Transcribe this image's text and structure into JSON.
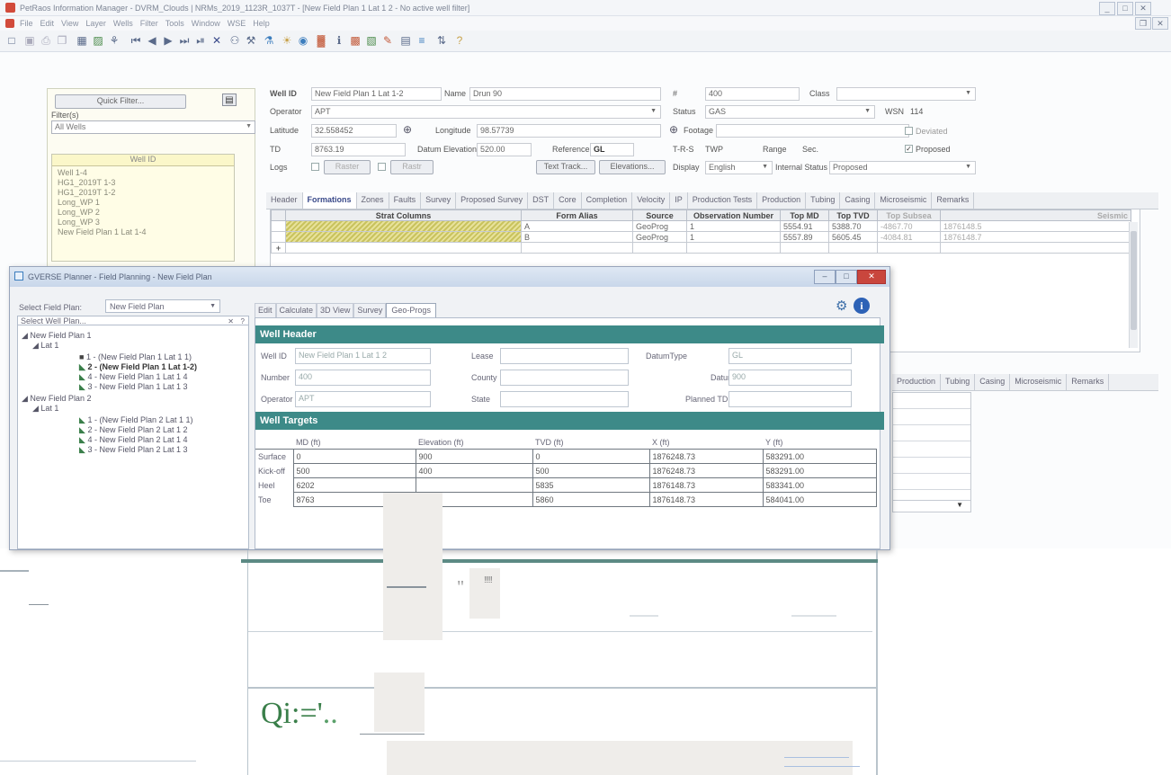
{
  "main_window": {
    "title": "PetRaos Information Manager - DVRM_Clouds | NRMs_2019_1123R_1037T - [New Field Plan 1 Lat 1 2 - No active well filter]",
    "menu": [
      "File",
      "Edit",
      "View",
      "Layer",
      "Wells",
      "Filter",
      "Tools",
      "Window",
      "WSE",
      "Help"
    ],
    "window_controls": [
      "_",
      "□",
      "✕"
    ],
    "toolbar_icons": [
      "new-doc-icon",
      "save-icon",
      "print-icon",
      "grid-icon",
      "chart-icon",
      "filter-icon",
      "first-icon",
      "prev-icon",
      "next-icon",
      "last-icon",
      "add-icon",
      "delete-icon",
      "binoculars-icon",
      "wrench-icon",
      "paint-icon",
      "tag-icon",
      "well-icon",
      "info-icon",
      "flag-icon",
      "check-icon",
      "edit-icon",
      "table-icon",
      "map-icon",
      "refresh-icon",
      "help-icon"
    ]
  },
  "left_panel": {
    "quick_filter_button": "Quick Filter...",
    "filter_label": "Filter(s)",
    "filter_value": "All Wells",
    "wells_header": "Well ID",
    "wells": [
      "Well 1-4",
      "HG1_2019T 1-3",
      "HG1_2019T 1-2",
      "Long_WP 1",
      "Long_WP 2",
      "Long_WP 3",
      "New Field Plan 1 Lat 1-4"
    ]
  },
  "header_form": {
    "well_id_label": "Well ID",
    "well_id_value": "New Field Plan 1 Lat 1-2",
    "name_label": "Name",
    "name_value": "Drun 90",
    "hash_label": "#",
    "hash_value": "400",
    "class_label": "Class",
    "class_value": "",
    "operator_label": "Operator",
    "operator_value": "APT",
    "status_label": "Status",
    "status_value": "GAS",
    "wsn_label": "WSN",
    "wsn_value": "114",
    "latitude_label": "Latitude",
    "latitude_value": "32.558452",
    "longitude_label": "Longitude",
    "longitude_value": "98.57739",
    "footage_label": "Footage",
    "deviated_label": "Deviated",
    "td_label": "TD",
    "td_value": "8763.19",
    "datum_label": "Datum Elevation",
    "datum_value": "520.00",
    "reference_label": "Reference",
    "reference_value": "GL",
    "trs_label": "T-R-S",
    "twp_label": "TWP",
    "range_label": "Range",
    "sec_label": "Sec.",
    "proposed_label": "Proposed",
    "logs_label": "Logs",
    "raster_label": "Raster",
    "rastr_label": "Rastr",
    "text_btn": "Text Track...",
    "elevations_btn": "Elevations...",
    "display_label": "Display",
    "display_value": "English",
    "internal_status_label": "Internal Status",
    "internal_status_value": "Proposed"
  },
  "tabs_top": [
    "Header",
    "Formations",
    "Zones",
    "Faults",
    "Survey",
    "Proposed Survey",
    "DST",
    "Core",
    "Completion",
    "Velocity",
    "IP",
    "Production Tests",
    "Production",
    "Tubing",
    "Casing",
    "Microseismic",
    "Remarks"
  ],
  "formations_grid": {
    "columns": [
      "Strat Columns",
      "Form Alias",
      "Source",
      "Observation Number",
      "Top MD",
      "Top TVD",
      "Top Subsea",
      "Seismic"
    ],
    "rows": [
      [
        "",
        "A",
        "GeoProg",
        "1",
        "5554.91",
        "5388.70",
        "-4867.70",
        "1876148.5"
      ],
      [
        "",
        "B",
        "GeoProg",
        "1",
        "5557.89",
        "5605.45",
        "-4084.81",
        "1876148.7"
      ]
    ],
    "new_row_marker": "+"
  },
  "tabs_lower": [
    "Production",
    "Tubing",
    "Casing",
    "Microseismic",
    "Remarks"
  ],
  "planner": {
    "title": "GVERSE Planner - Field Planning - New Field Plan",
    "select_label": "Select Field Plan:",
    "select_value": "New Field Plan",
    "selector_value": "Select Well Plan...",
    "tabs": [
      "Edit",
      "Calculate",
      "3D View",
      "Survey",
      "Geo-Progs"
    ],
    "tree": [
      "New Field Plan 1",
      "Lat 1",
      "1 - (New Field Plan 1 Lat 1 1)",
      "2 - (New Field Plan 1 Lat 1-2)",
      "4 - New Field Plan 1 Lat 1 4",
      "3 - New Field Plan 1 Lat 1 3",
      "New Field Plan 2",
      "Lat 1",
      "1 - (New Field Plan 2 Lat 1 1)",
      "2 - New Field Plan 2 Lat 1 2",
      "4 - New Field Plan 2 Lat 1 4",
      "3 - New Field Plan 2 Lat 1 3"
    ],
    "well_header_title": "Well Header",
    "well_header": {
      "well_id_label": "Well ID",
      "well_id_value": "New Field Plan 1 Lat 1 2",
      "number_label": "Number",
      "number_value": "400",
      "operator_label": "Operator",
      "operator_value": "APT",
      "lease_label": "Lease",
      "county_label": "County",
      "state_label": "State",
      "datum_type_label": "DatumType",
      "datum_type_value": "GL",
      "datum_label": "Datum",
      "datum_value": "900",
      "planned_td_label": "Planned TD"
    },
    "targets_title": "Well Targets",
    "targets": {
      "columns": [
        "",
        "MD (ft)",
        "Elevation (ft)",
        "TVD (ft)",
        "X (ft)",
        "Y (ft)"
      ],
      "rows": [
        [
          "Surface",
          "0",
          "900",
          "0",
          "1876248.73",
          "583291.00"
        ],
        [
          "Kick-off",
          "500",
          "400",
          "500",
          "1876248.73",
          "583291.00"
        ],
        [
          "Heel",
          "6202",
          "",
          "5835",
          "1876148.73",
          "583341.00"
        ],
        [
          "Toe",
          "8763",
          "",
          "5860",
          "1876148.73",
          "584041.00"
        ]
      ]
    }
  },
  "scanned_fragment": {
    "quote_mark": "\"",
    "ticks": "!!!!!",
    "ocr_text_main": "Qi:='",
    "ocr_text_dots": ".."
  },
  "colors": {
    "teal": "#3d8a88",
    "hatch": "#d6d07a",
    "ocr_green": "#3a7f4a"
  }
}
